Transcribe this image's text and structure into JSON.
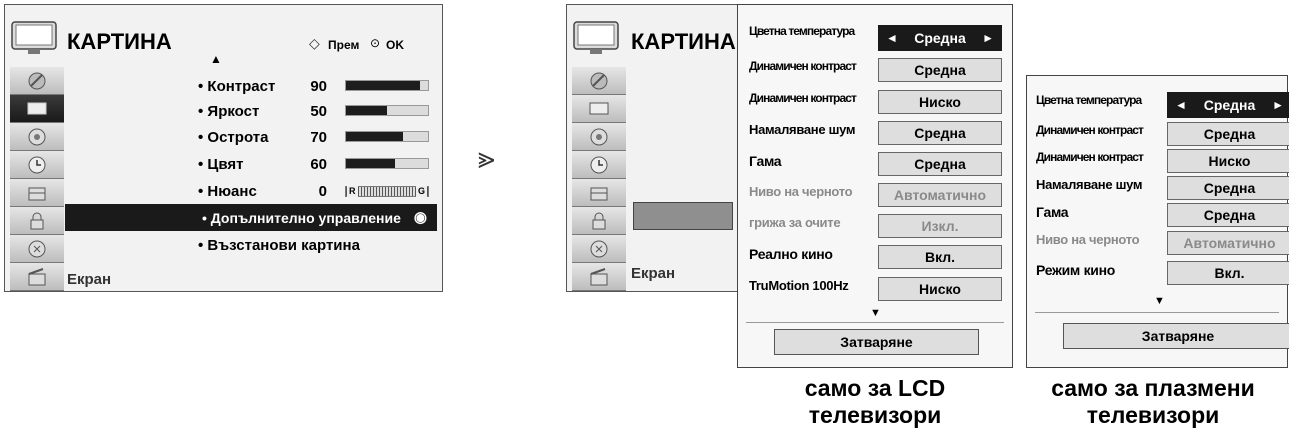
{
  "main_menu": {
    "title": "КАРТИНА",
    "nav_hint": "Прем",
    "ok_hint": "OK",
    "items": [
      {
        "label": "• Контраст",
        "value": "90",
        "level": 0.9
      },
      {
        "label": "• Яркост",
        "value": "50",
        "level": 0.5
      },
      {
        "label": "• Острота",
        "value": "70",
        "level": 0.7
      },
      {
        "label": "• Цвят",
        "value": "60",
        "level": 0.6
      },
      {
        "label": "• Нюанс",
        "value": "0",
        "tint_left": "R",
        "tint_right": "G"
      }
    ],
    "selected_item": "• Допълнително управление",
    "reset_item": "• Възстанови картина",
    "footer": "Екран"
  },
  "arrow_glyph": "⪢",
  "lcd_menu": {
    "title": "КАРТИНА",
    "footer": "Екран",
    "options": [
      {
        "label": "Цветна температура",
        "value": "Средна"
      },
      {
        "label": "Динамичен контраст",
        "value": "Средна"
      },
      {
        "label": "Динамичен контраст",
        "value": "Ниско"
      },
      {
        "label": "Намаляване шум",
        "value": "Средна"
      },
      {
        "label": "Гама",
        "value": "Средна"
      },
      {
        "label": "Ниво на черното",
        "value": "Автоматично"
      },
      {
        "label": "грижа за очите",
        "value": "Изкл."
      },
      {
        "label": "Реално кино",
        "value": "Вкл."
      },
      {
        "label": "TruMotion 100Hz",
        "value": "Ниско"
      }
    ],
    "close_label": "Затваряне",
    "caption_line1": "само за LCD",
    "caption_line2": "телевизори"
  },
  "plasma_menu": {
    "options": [
      {
        "label": "Цветна температура",
        "value": "Средна"
      },
      {
        "label": "Динамичен контраст",
        "value": "Средна"
      },
      {
        "label": "Динамичен контраст",
        "value": "Ниско"
      },
      {
        "label": "Намаляване шум",
        "value": "Средна"
      },
      {
        "label": "Гама",
        "value": "Средна"
      },
      {
        "label": "Ниво на черното",
        "value": "Автоматично"
      },
      {
        "label": "Режим кино",
        "value": "Вкл."
      }
    ],
    "close_label": "Затваряне",
    "caption_line1": "само за плазмени",
    "caption_line2": "телевизори"
  },
  "arrows": {
    "left": "◄",
    "right": "►",
    "up": "▲",
    "down": "▼"
  },
  "colors": {
    "panel": "#f2f2f2",
    "selection": "#1a1a1a",
    "button": "#dedede",
    "disabled_text": "#8a8a8a"
  }
}
